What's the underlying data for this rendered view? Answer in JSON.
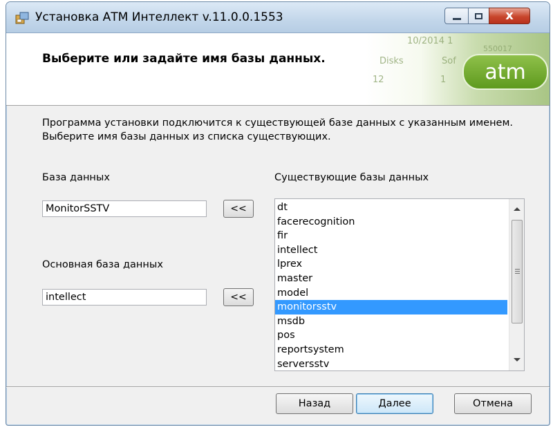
{
  "window": {
    "title": "Установка АТМ Интеллект v.11.0.0.1553",
    "controls": {
      "minimize": "minimize-icon",
      "maximize": "maximize-icon",
      "close": "x"
    }
  },
  "header": {
    "title": "Выберите или задайте имя базы данных.",
    "banner_fragments": [
      "10/2014 1",
      "550017",
      "Disks",
      "Sof",
      "12",
      "1"
    ],
    "logo_text": "atm"
  },
  "description": {
    "line1": "Программа установки подключится к существующей базе данных с указанным именем.",
    "line2": "Выберите имя базы данных из списка существующих."
  },
  "database": {
    "label": "База данных",
    "value": "MonitorSSTV",
    "button": "<<"
  },
  "main_database": {
    "label": "Основная база данных",
    "value": "intellect",
    "button": "<<"
  },
  "existing": {
    "label": "Существующие базы данных",
    "items": [
      "dt",
      "facerecognition",
      "fir",
      "intellect",
      "lprex",
      "master",
      "model",
      "monitorsstv",
      "msdb",
      "pos",
      "reportsystem",
      "serversstv"
    ],
    "selected": "monitorsstv"
  },
  "buttons": {
    "back": "Назад",
    "next": "Далее",
    "cancel": "Отмена"
  },
  "colors": {
    "selection": "#3399ff",
    "logo_green": "#6ea82a",
    "close_red": "#c8462c"
  }
}
